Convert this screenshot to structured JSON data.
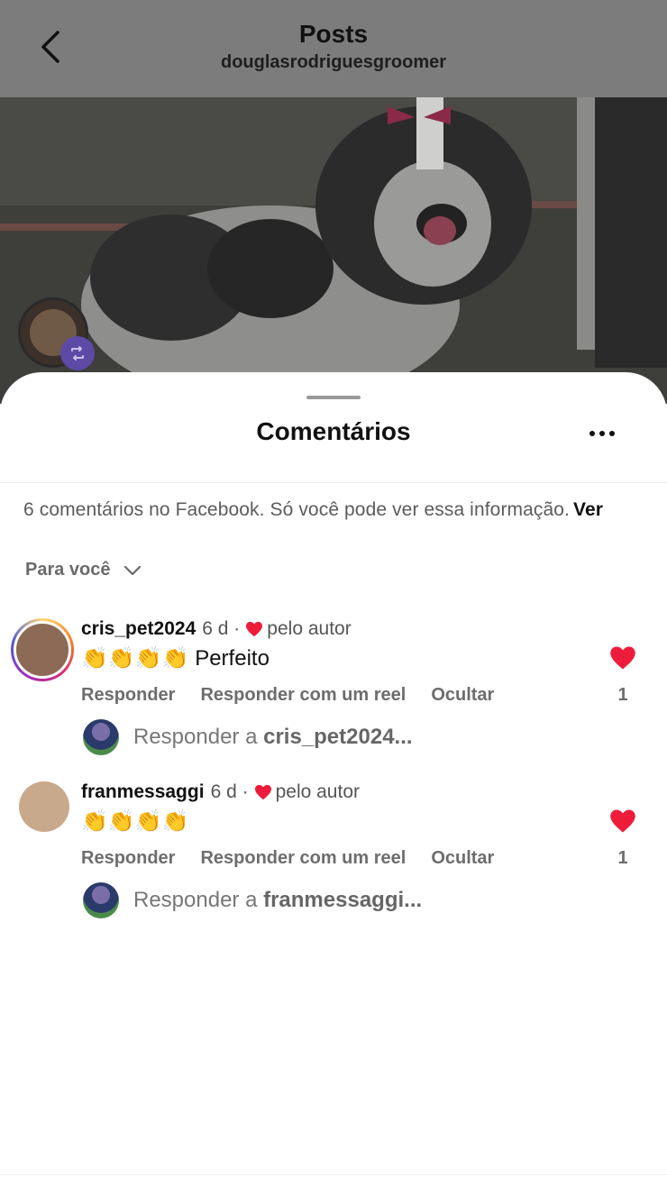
{
  "header": {
    "title": "Posts",
    "subtitle": "douglasrodriguesgroomer"
  },
  "sheet": {
    "title": "Comentários",
    "facebook_note": "6 comentários no Facebook. Só você pode ver essa informação.",
    "facebook_note_action": "Ver",
    "sort_label": "Para você"
  },
  "comments": [
    {
      "username": "cris_pet2024",
      "time": "6 d ·",
      "liked_by_author": "pelo autor",
      "text": "👏👏👏👏 Perfeito",
      "actions": [
        "Responder",
        "Responder com um reel",
        "Ocultar"
      ],
      "likes": "1",
      "reply_prefix": "Responder a ",
      "reply_target": "cris_pet2024..."
    },
    {
      "username": "franmessaggi",
      "time": "6 d ·",
      "liked_by_author": "pelo autor",
      "text": "👏👏👏👏",
      "actions": [
        "Responder",
        "Responder com um reel",
        "Ocultar"
      ],
      "likes": "1",
      "reply_prefix": "Responder a ",
      "reply_target": "franmessaggi..."
    }
  ],
  "colors": {
    "like_red": "#ed1c3a",
    "overlay_gray": "#7c7c7c",
    "repost_badge": "#5d4aa6"
  },
  "icons": {
    "back": "chevron-left-icon",
    "more": "more-horizontal-icon",
    "sort": "chevron-down-icon",
    "like": "heart-icon",
    "repost": "repost-icon"
  }
}
